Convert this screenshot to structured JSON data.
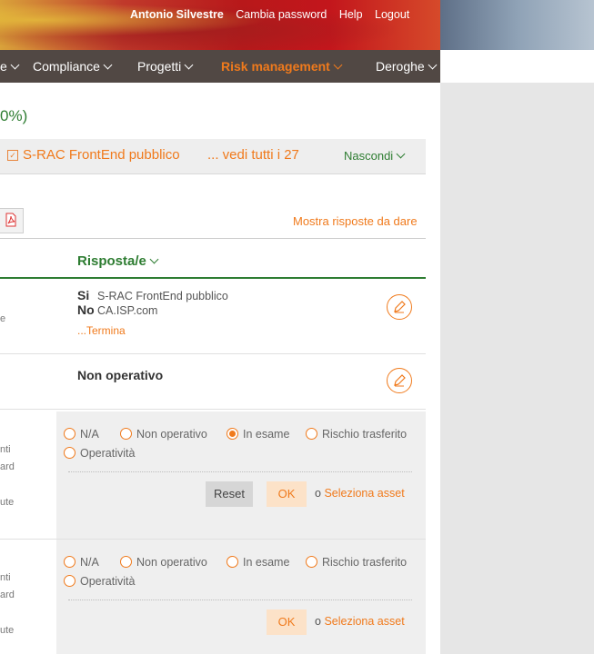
{
  "header": {
    "user_name": "Antonio Silvestre",
    "change_password": "Cambia password",
    "help": "Help",
    "logout": "Logout"
  },
  "nav": {
    "items": [
      "e",
      "Compliance",
      "Progetti",
      "Risk management",
      "Deroghe"
    ],
    "active": "Risk management"
  },
  "page": {
    "percent_fragment": "0%)"
  },
  "filter": {
    "selected": "S-RAC FrontEnd pubblico",
    "see_all": "... vedi tutti i 27",
    "hide": "Nascondi"
  },
  "toolbar": {
    "show_answers": "Mostra risposte da dare"
  },
  "table": {
    "answer_header": "Risposta/e"
  },
  "rows": [
    {
      "answers": [
        {
          "key": "Si",
          "value": "S-RAC FrontEnd pubblico"
        },
        {
          "key": "No",
          "value": "CA.ISP.com"
        }
      ],
      "more": "...Termina",
      "left_fragment": "e"
    },
    {
      "value": "Non operativo"
    }
  ],
  "questions": [
    {
      "left_fragments": [
        "nti",
        "ard",
        "ute"
      ],
      "options": [
        "N/A",
        "Non operativo",
        "In esame",
        "Rischio trasferito",
        "Operatività"
      ],
      "selected": "In esame",
      "reset_label": "Reset",
      "ok_label": "OK",
      "or_label": "o",
      "select_asset": "Seleziona asset"
    },
    {
      "left_fragments": [
        "nti",
        "ard",
        "ute"
      ],
      "options": [
        "N/A",
        "Non operativo",
        "In esame",
        "Rischio trasferito",
        "Operatività"
      ],
      "selected": "",
      "ok_label": "OK",
      "or_label": "o",
      "select_asset": "Seleziona asset"
    }
  ]
}
